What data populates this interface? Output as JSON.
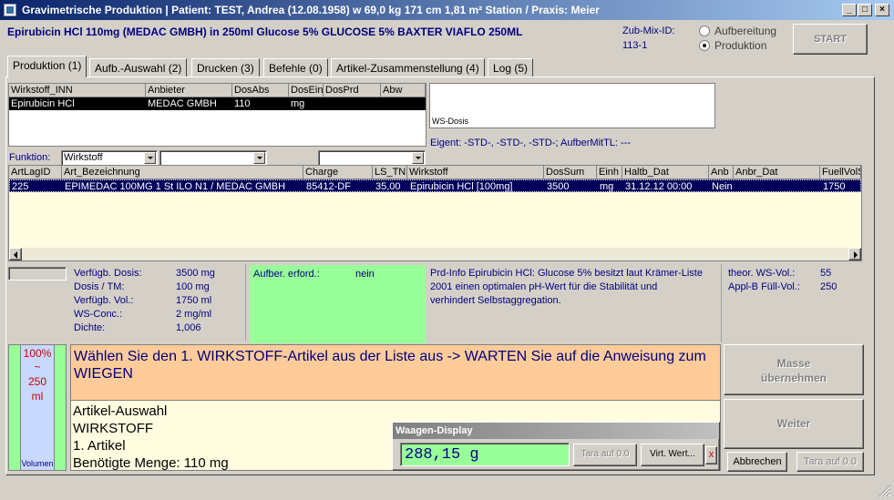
{
  "window": {
    "title": "Gravimetrische Produktion  |  Patient: TEST, Andrea (12.08.1958) w 69,0 kg  171 cm  1,81 m² Station / Praxis: Meier",
    "controls": {
      "minimize": "_",
      "maximize": "□",
      "close": "×"
    }
  },
  "header": {
    "product": "Epirubicin HCl 110mg (MEDAC GMBH) in 250ml Glucose 5% GLUCOSE 5% BAXTER VIAFLO 250ML",
    "zub_mix_label": "Zub-Mix-ID:",
    "zub_mix_value": "113-1",
    "radio_aufbereitung": "Aufbereitung",
    "radio_produktion": "Produktion",
    "start_label": "START"
  },
  "tabs": [
    {
      "label": "Produktion (1)",
      "active": true
    },
    {
      "label": "Aufb.-Auswahl (2)",
      "active": false
    },
    {
      "label": "Drucken (3)",
      "active": false
    },
    {
      "label": "Befehle (0)",
      "active": false
    },
    {
      "label": "Artikel-Zusammenstellung (4)",
      "active": false
    },
    {
      "label": "Log (5)",
      "active": false
    }
  ],
  "wirkstoff_table": {
    "headers": [
      "Wirkstoff_INN",
      "Anbieter",
      "DosAbs",
      "DosEin",
      "DosPrd",
      "Abw"
    ],
    "rows": [
      [
        "Epirubicin HCl",
        "MEDAC GMBH",
        "110",
        "mg",
        "",
        ""
      ]
    ]
  },
  "ws_dosis_label": "WS-Dosis",
  "eigent_text": "Eigent: -STD-, -STD-, -STD-; AufberMitTL: ---",
  "funktion": {
    "label": "Funktion:",
    "select1": "Wirkstoff",
    "select2": "",
    "select3": ""
  },
  "artikel_table": {
    "headers": [
      "ArtLagID",
      "Art_Bezeichnung",
      "Charge",
      "LS_TN",
      "Wirkstoff",
      "DosSum",
      "Einh",
      "Haltb_Dat",
      "Anb",
      "Anbr_Dat",
      "FuellVolS"
    ],
    "rows": [
      [
        "225",
        "EPIMEDAC 100MG    1 St ILO N1 / MEDAC GMBH",
        "85412-DF",
        "35,00",
        "Epirubicin HCl [100mg]",
        "3500",
        "mg",
        "31.12.12 00:00",
        "Nein",
        "",
        "1750"
      ]
    ]
  },
  "info": {
    "verfuegb_dosis_label": "Verfügb. Dosis:",
    "verfuegb_dosis_value": "3500 mg",
    "dosis_tm_label": "Dosis / TM:",
    "dosis_tm_value": "100 mg",
    "verfuegb_vol_label": "Verfügb. Vol.:",
    "verfuegb_vol_value": "1750 ml",
    "ws_conc_label": "WS-Conc.:",
    "ws_conc_value": "2 mg/ml",
    "dichte_label": "Dichte:",
    "dichte_value": "1,006",
    "aufber_label": "Aufber. erford.:",
    "aufber_value": "nein",
    "prd_info": "Prd-Info Epirubicin HCl: Glucose 5% besitzt laut Krämer-Liste 2001 einen optimalen pH-Wert für die Stabilität und verhindert Selbstaggregation.",
    "theor_ws_vol_label": "theor. WS-Vol.:",
    "theor_ws_vol_value": "55",
    "appl_b_label": "Appl-B Füll-Vol.:",
    "appl_b_value": "250"
  },
  "volumen_gauge": {
    "percent_text": "100%",
    "tilde": "~",
    "ml_value": "250",
    "ml_unit": "ml",
    "label": "Volumen",
    "fill_fraction": 1.0
  },
  "instruction": "Wählen Sie den 1. WIRKSTOFF-Artikel aus der Liste aus -> WARTEN Sie auf die Anweisung zum WIEGEN",
  "artikel_auswahl": [
    "Artikel-Auswahl",
    "WIRKSTOFF",
    "1. Artikel",
    "Benötigte Menge: 110 mg"
  ],
  "waagen": {
    "title": "Waagen-Display",
    "value": "288,15 g",
    "tara_label": "Tara auf 0.0",
    "virt_label": "Virt. Wert...",
    "x_label": "x"
  },
  "buttons": {
    "masse_line1": "Masse",
    "masse_line2": "übernehmen",
    "weiter": "Weiter",
    "abbrechen": "Abbrechen",
    "tara_bottom": "Tara auf 0.0"
  },
  "colors": {
    "title_start": "#0a246a",
    "title_end": "#a6caf0",
    "header_blue": "#00007f",
    "instruction_bg": "#ffcc99",
    "green_panel": "#99ff99",
    "gauge_blue": "#c8d8ff",
    "gauge_text": "#cc0000",
    "cream": "#fffce0"
  }
}
